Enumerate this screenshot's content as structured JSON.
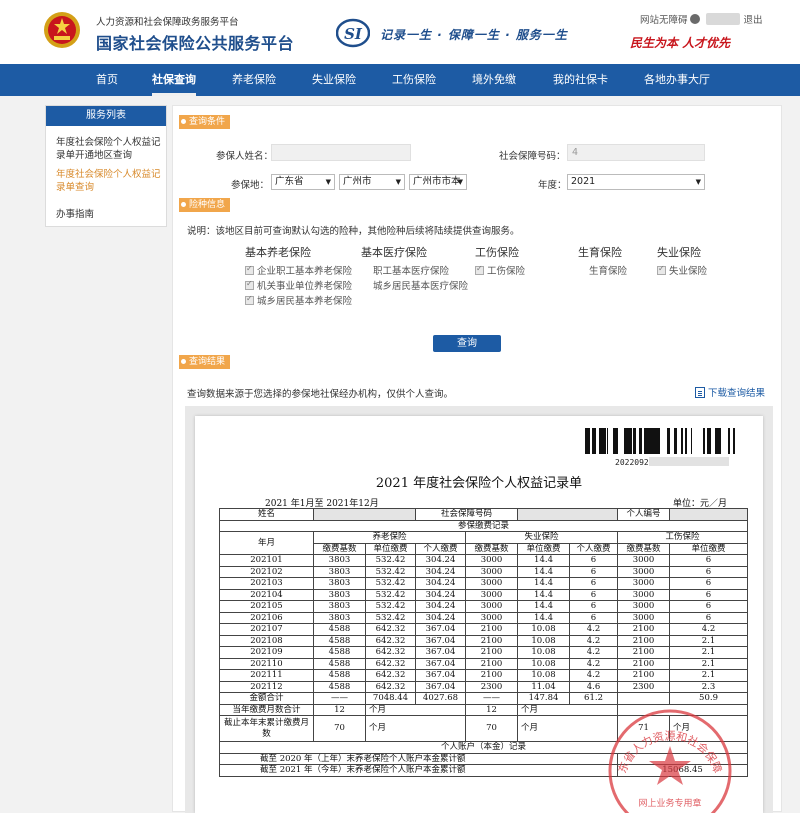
{
  "header": {
    "org_subtitle": "人力资源和社会保障政务服务平台",
    "org_title": "国家社会保险公共服务平台",
    "slogan": "记录一生 · 保障一生 · 服务一生",
    "user_prefix": "网站无障碍",
    "logout": "退出",
    "motto": "民生为本  人才优先"
  },
  "nav": [
    "首页",
    "社保查询",
    "养老保险",
    "失业保险",
    "工伤保险",
    "境外免缴",
    "我的社保卡",
    "各地办事大厅"
  ],
  "sidebar": {
    "title": "服务列表",
    "items": [
      "年度社会保险个人权益记录单开通地区查询",
      "年度社会保险个人权益记录单查询",
      "办事指南"
    ]
  },
  "query": {
    "section_conditions": "查询条件",
    "name_label": "参保人姓名：",
    "ssn_label": "社会保障号码：",
    "ssn_value": "4",
    "place_label": "参保地：",
    "province": "广东省",
    "city": "广州市",
    "district": "广州市市本",
    "year_label": "年度：",
    "year": "2021",
    "section_types": "险种信息",
    "note": "说明：该地区目前可查询默认勾选的险种，其他险种后续将陆续提供查询服务。",
    "categories": {
      "pension": "基本养老保险",
      "medical": "基本医疗保险",
      "injury": "工伤保险",
      "maternity": "生育保险",
      "unemployment": "失业保险"
    },
    "options": {
      "pension_enterprise": "企业职工基本养老保险",
      "pension_institution": "机关事业单位养老保险",
      "pension_resident": "城乡居民基本养老保险",
      "medical_employee": "职工基本医疗保险",
      "medical_resident": "城乡居民基本医疗保险",
      "injury": "工伤保险",
      "maternity": "生育保险",
      "unemployment": "失业保险"
    },
    "button": "查询"
  },
  "result": {
    "section": "查询结果",
    "note": "查询数据来源于您选择的参保地社保经办机构，仅供个人查询。",
    "download": "下载查询结果"
  },
  "document": {
    "barcode_number": "2022092",
    "title": "2021 年度社会保险个人权益记录单",
    "period": "2021 年1月至 2021年12月",
    "unit": "单位：元／月",
    "name_label": "姓名",
    "ssn_label": "社会保障号码",
    "id_label": "个人编号",
    "section_payment": "参保缴费记录",
    "col_month": "年月",
    "col_pension": "养老保险",
    "col_unemployment": "失业保险",
    "col_injury": "工伤保险",
    "col_base": "缴费基数",
    "col_unit_pay": "单位缴费",
    "col_personal_pay": "个人缴费",
    "rows": [
      [
        "202101",
        "3803",
        "532.42",
        "304.24",
        "3000",
        "14.4",
        "6",
        "3000",
        "6"
      ],
      [
        "202102",
        "3803",
        "532.42",
        "304.24",
        "3000",
        "14.4",
        "6",
        "3000",
        "6"
      ],
      [
        "202103",
        "3803",
        "532.42",
        "304.24",
        "3000",
        "14.4",
        "6",
        "3000",
        "6"
      ],
      [
        "202104",
        "3803",
        "532.42",
        "304.24",
        "3000",
        "14.4",
        "6",
        "3000",
        "6"
      ],
      [
        "202105",
        "3803",
        "532.42",
        "304.24",
        "3000",
        "14.4",
        "6",
        "3000",
        "6"
      ],
      [
        "202106",
        "3803",
        "532.42",
        "304.24",
        "3000",
        "14.4",
        "6",
        "3000",
        "6"
      ],
      [
        "202107",
        "4588",
        "642.32",
        "367.04",
        "2100",
        "10.08",
        "4.2",
        "2100",
        "4.2"
      ],
      [
        "202108",
        "4588",
        "642.32",
        "367.04",
        "2100",
        "10.08",
        "4.2",
        "2100",
        "2.1"
      ],
      [
        "202109",
        "4588",
        "642.32",
        "367.04",
        "2100",
        "10.08",
        "4.2",
        "2100",
        "2.1"
      ],
      [
        "202110",
        "4588",
        "642.32",
        "367.04",
        "2100",
        "10.08",
        "4.2",
        "2100",
        "2.1"
      ],
      [
        "202111",
        "4588",
        "642.32",
        "367.04",
        "2100",
        "10.08",
        "4.2",
        "2100",
        "2.1"
      ],
      [
        "202112",
        "4588",
        "642.32",
        "367.04",
        "2300",
        "11.04",
        "4.6",
        "2300",
        "2.3"
      ]
    ],
    "total_label": "金额合计",
    "total_row": [
      "——",
      "7048.44",
      "4027.68",
      "——",
      "147.84",
      "61.2",
      "",
      "50.9"
    ],
    "months_label": "当年缴费月数合计",
    "months_pension": "12",
    "months_unemployment": "12",
    "months_unit": "个月",
    "cumulative_label": "截止本年末累计缴费月数",
    "cum_pension": "70",
    "cum_unemployment": "70",
    "cum_injury": "71",
    "account_section": "个人账户（本金）记录",
    "account_row1": "截至    2020    年（上年）末养老保险个人账户本金累计额",
    "account_row2": "截至    2021    年（今年）末养老保险个人账户本金累计额",
    "account_value2": "15068.45",
    "stamp_text": "广东省人力资源和社会保障厅",
    "stamp_sub": "网上业务专用章"
  }
}
